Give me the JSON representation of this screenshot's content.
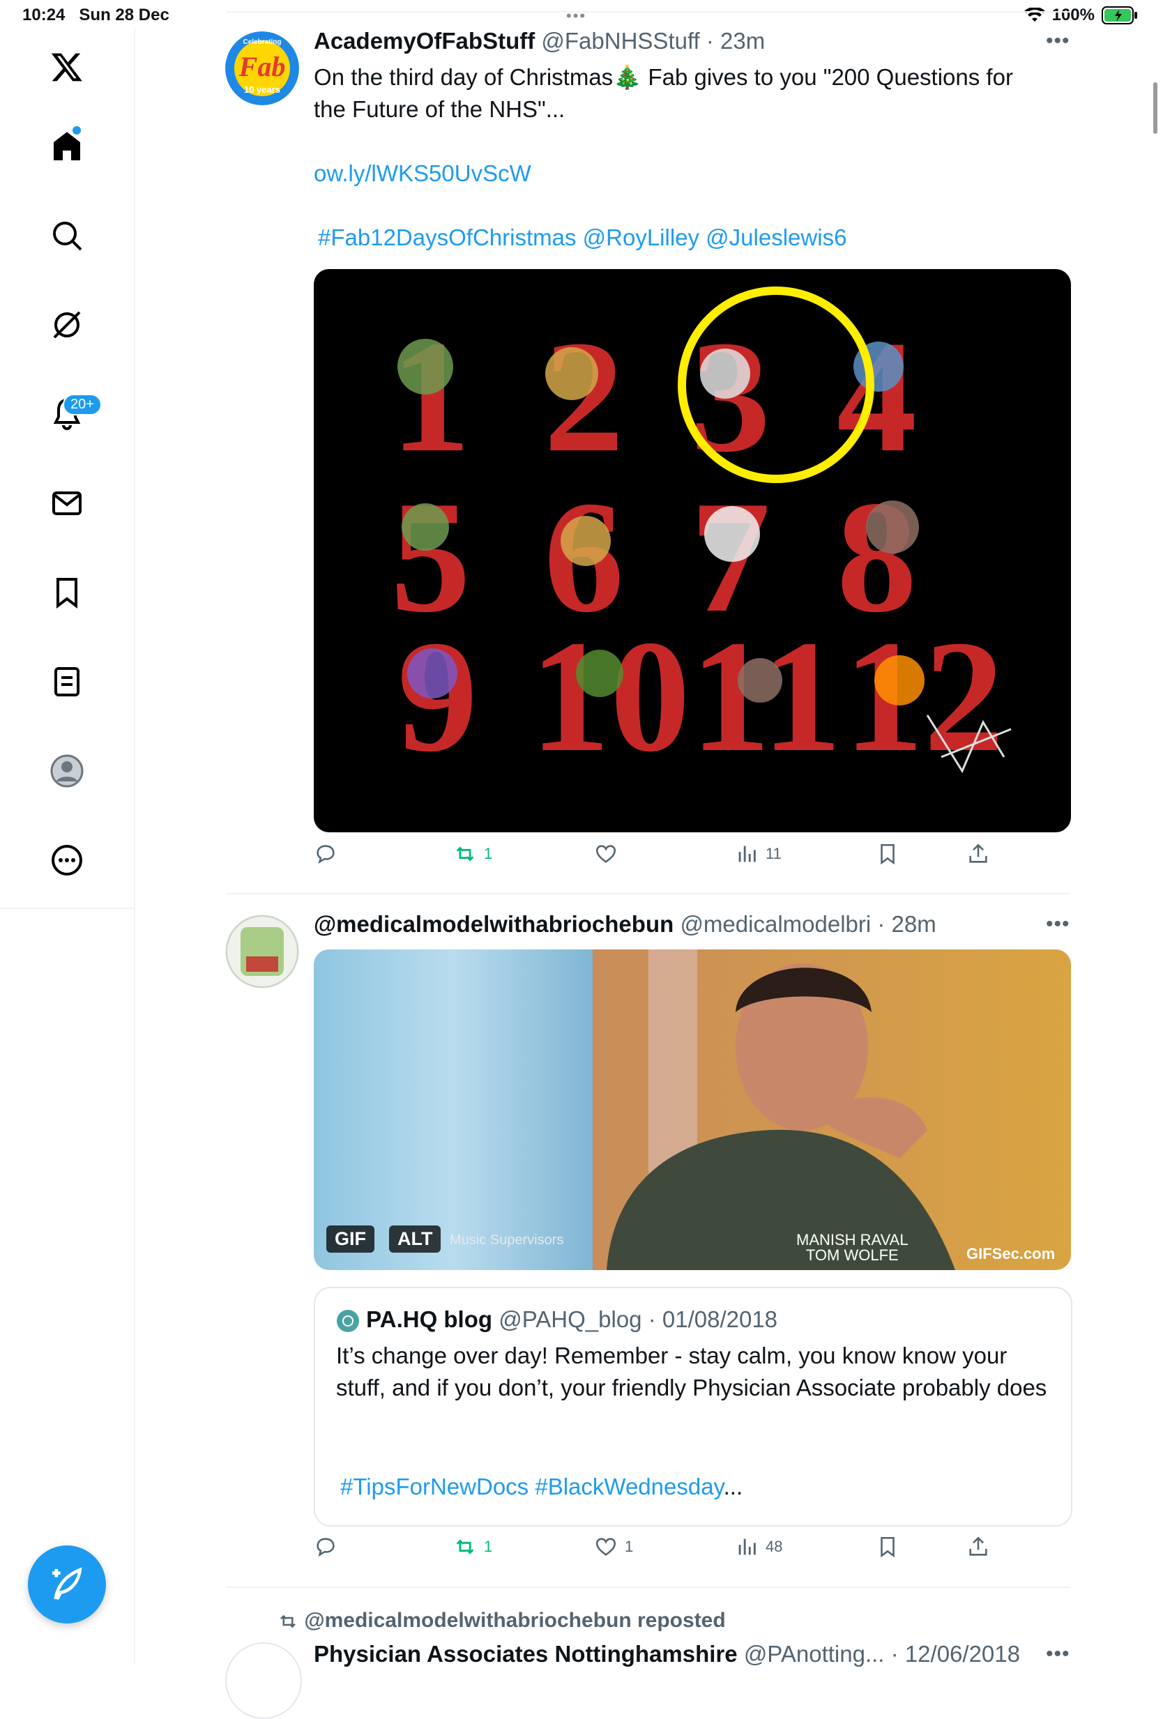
{
  "status_bar": {
    "time": "10:24",
    "date": "Sun 28 Dec",
    "battery": "100%"
  },
  "sidebar": {
    "notifications_badge": "20+"
  },
  "tweet1": {
    "avatar_text_top": "Celebrating",
    "avatar_text_main": "Fab",
    "avatar_text_bottom": "10 years",
    "name": "AcademyOfFabStuff",
    "handle": "@FabNHSStuff",
    "time": "· 23m",
    "text_line1": "On the third day of Christmas🎄 Fab gives to you \"200 Questions for",
    "text_line2": "the Future of the NHS\"...",
    "link": "ow.ly/lWKS50UvScW",
    "tags": "#Fab12DaysOfChristmas @RoyLilley @Juleslewis6",
    "actions": {
      "retweets": "1",
      "views": "11"
    }
  },
  "tweet2": {
    "name": "@medicalmodelwithabriochebun",
    "handle": "@medicalmodelbri",
    "time": "· 28m",
    "gif_badge": "GIF",
    "alt_badge": "ALT",
    "gif_caption_left": "Music Supervisors",
    "gif_caption_right_1": "MANISH RAVAL",
    "gif_caption_right_2": "TOM WOLFE",
    "gif_watermark": "GIFSec.com",
    "quote": {
      "name": "PA.HQ blog",
      "handle": "@PAHQ_blog",
      "date": "· 01/08/2018",
      "text": "It’s change over day! Remember - stay calm, you know know your stuff, and if you don’t, your friendly Physician Associate probably does",
      "tags": "#TipsForNewDocs  #BlackWednesday",
      "tags_suffix": "..."
    },
    "actions": {
      "retweets": "1",
      "likes": "1",
      "views": "48"
    }
  },
  "tweet3": {
    "repost_label": "@medicalmodelwithabriochebun reposted",
    "name": "Physician Associates Nottinghamshire",
    "handle": "@PAnotting...",
    "date": "· 12/06/2018"
  },
  "colors": {
    "accent": "#1d9bf0",
    "retweet_green": "#00ba7c",
    "muted": "#536471"
  }
}
